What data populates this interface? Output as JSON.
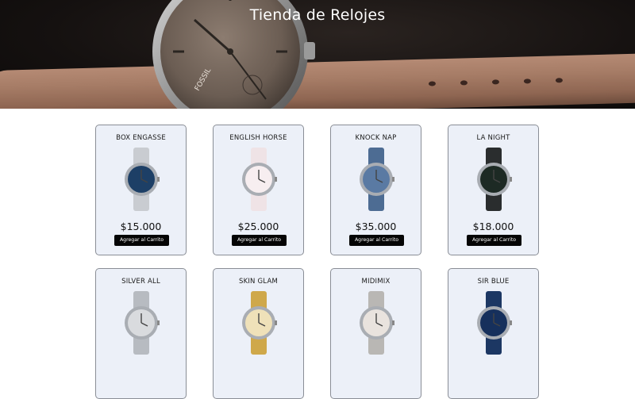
{
  "header": {
    "title": "Tienda de Relojes",
    "brand_on_image": "FOSSIL"
  },
  "products": [
    {
      "name": "BOX ENGASSE",
      "price": "$15.000",
      "button": "Agregar al Carrito",
      "image": "chronograph-steel-watch",
      "face_color": "#1d3f66",
      "band_color": "#c9ccd1"
    },
    {
      "name": "ENGLISH HORSE",
      "price": "$25.000",
      "button": "Agregar al Carrito",
      "image": "pink-white-watch",
      "face_color": "#f7eef0",
      "band_color": "#efe3e6"
    },
    {
      "name": "KNOCK NAP",
      "price": "$35.000",
      "button": "Agregar al Carrito",
      "image": "blue-plastic-watch",
      "face_color": "#5a7aa3",
      "band_color": "#4d6c93"
    },
    {
      "name": "LA NIGHT",
      "price": "$18.000",
      "button": "Agregar al Carrito",
      "image": "black-green-watch",
      "face_color": "#1d2a24",
      "band_color": "#2a2d2e"
    },
    {
      "name": "SILVER ALL",
      "price": "",
      "button": "",
      "image": "silver-mesh-watch",
      "face_color": "#d9dbde",
      "band_color": "#b7bbc1"
    },
    {
      "name": "SKIN GLAM",
      "price": "",
      "button": "",
      "image": "gold-watch",
      "face_color": "#efe1b9",
      "band_color": "#cfa84a"
    },
    {
      "name": "MIDIMIX",
      "price": "",
      "button": "",
      "image": "rose-silver-watch",
      "face_color": "#e9e3de",
      "band_color": "#b9b7b4"
    },
    {
      "name": "SIR BLUE",
      "price": "",
      "button": "",
      "image": "navy-blue-watch",
      "face_color": "#16305c",
      "band_color": "#1c3763"
    }
  ]
}
